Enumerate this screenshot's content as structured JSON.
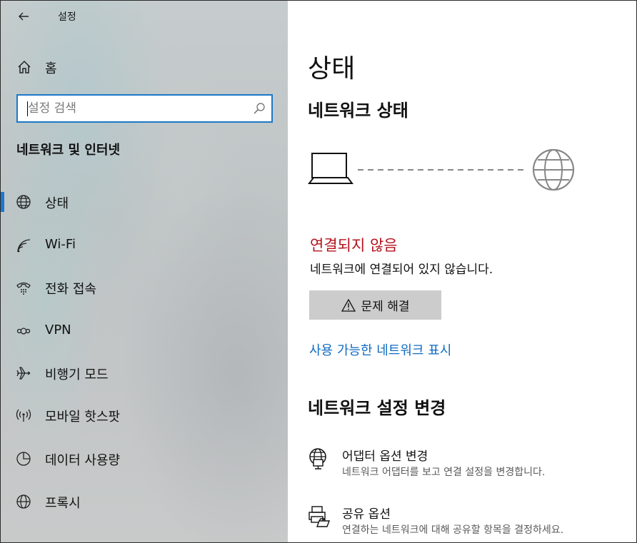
{
  "window": {
    "title": "설정"
  },
  "sidebar": {
    "home_label": "홈",
    "search": {
      "placeholder": "설정 검색",
      "value": ""
    },
    "section_title": "네트워크 및 인터넷",
    "items": [
      {
        "label": "상태",
        "icon": "globe-icon",
        "active": true
      },
      {
        "label": "Wi-Fi",
        "icon": "wifi-icon",
        "active": false
      },
      {
        "label": "전화 접속",
        "icon": "dialup-icon",
        "active": false
      },
      {
        "label": "VPN",
        "icon": "vpn-icon",
        "active": false
      },
      {
        "label": "비행기 모드",
        "icon": "airplane-icon",
        "active": false
      },
      {
        "label": "모바일 핫스팟",
        "icon": "hotspot-icon",
        "active": false
      },
      {
        "label": "데이터 사용량",
        "icon": "data-usage-icon",
        "active": false
      },
      {
        "label": "프록시",
        "icon": "proxy-globe-icon",
        "active": false
      }
    ]
  },
  "main": {
    "page_title": "상태",
    "network_status_title": "네트워크 상태",
    "connection_title": "연결되지 않음",
    "connection_desc": "네트워크에 연결되어 있지 않습니다.",
    "troubleshoot_label": "문제 해결",
    "show_networks_link": "사용 가능한 네트워크 표시",
    "change_settings_title": "네트워크 설정 변경",
    "settings": [
      {
        "label": "어댑터 옵션 변경",
        "desc": "네트워크 어댑터를 보고 연결 설정을 변경합니다.",
        "icon": "adapter-icon"
      },
      {
        "label": "공유 옵션",
        "desc": "연결하는 네트워크에 대해 공유할 항목을 결정하세요.",
        "icon": "sharing-icon"
      }
    ]
  },
  "colors": {
    "accent": "#1a78d0",
    "error": "#b3131d",
    "link": "#0f6bc2",
    "button_bg": "#cccccc"
  }
}
